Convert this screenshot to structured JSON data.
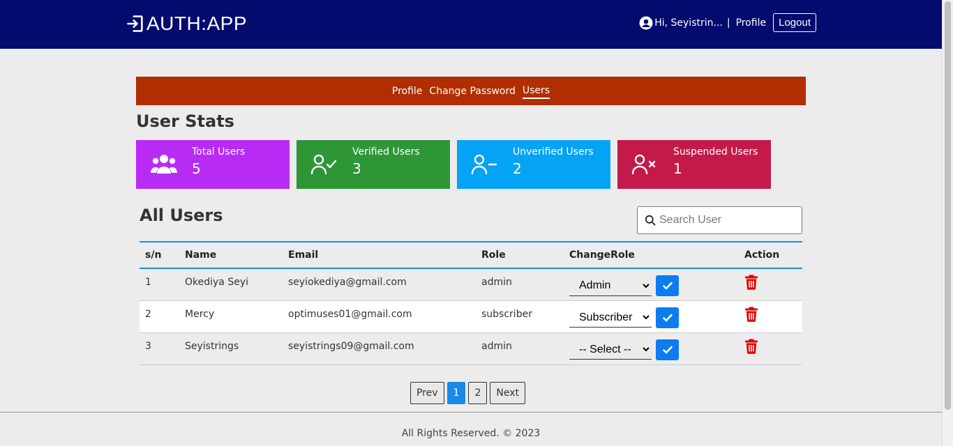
{
  "header": {
    "logo_text": "AUTH:APP",
    "greeting": "Hi, Seyistrin...",
    "separator": "|",
    "profile_link": "Profile",
    "logout_label": "Logout"
  },
  "subnav": {
    "items": [
      {
        "label": "Profile"
      },
      {
        "label": "Change Password"
      },
      {
        "label": "Users",
        "active": true
      }
    ]
  },
  "stats": {
    "title": "User Stats",
    "cards": [
      {
        "label": "Total Users",
        "value": "5",
        "icon": "users-group-icon",
        "color": "#b82bf5"
      },
      {
        "label": "Verified Users",
        "value": "3",
        "icon": "user-check-icon",
        "color": "#2e9637"
      },
      {
        "label": "Unverified Users",
        "value": "2",
        "icon": "user-minus-icon",
        "color": "#05a3f3"
      },
      {
        "label": "Suspended Users",
        "value": "1",
        "icon": "user-x-icon",
        "color": "#c41a4b"
      }
    ]
  },
  "users": {
    "title": "All Users",
    "search_placeholder": "Search User",
    "columns": [
      "s/n",
      "Name",
      "Email",
      "Role",
      "ChangeRole",
      "Action"
    ],
    "rows": [
      {
        "sn": "1",
        "name": "Okediya Seyi",
        "email": "seyiokediya@gmail.com",
        "role": "admin",
        "select": "Admin"
      },
      {
        "sn": "2",
        "name": "Mercy",
        "email": "optimuses01@gmail.com",
        "role": "subscriber",
        "select": "Subscriber"
      },
      {
        "sn": "3",
        "name": "Seyistrings",
        "email": "seyistrings09@gmail.com",
        "role": "admin",
        "select": "-- Select --"
      }
    ]
  },
  "pagination": {
    "prev": "Prev",
    "pages": [
      "1",
      "2"
    ],
    "current": "1",
    "next": "Next"
  },
  "footer": {
    "text": "All Rights Reserved. © 2023"
  },
  "colors": {
    "header_bg": "#030b6e",
    "subnav_bg": "#b02e00",
    "accent": "#1a8ae8",
    "delete": "#e00000"
  }
}
